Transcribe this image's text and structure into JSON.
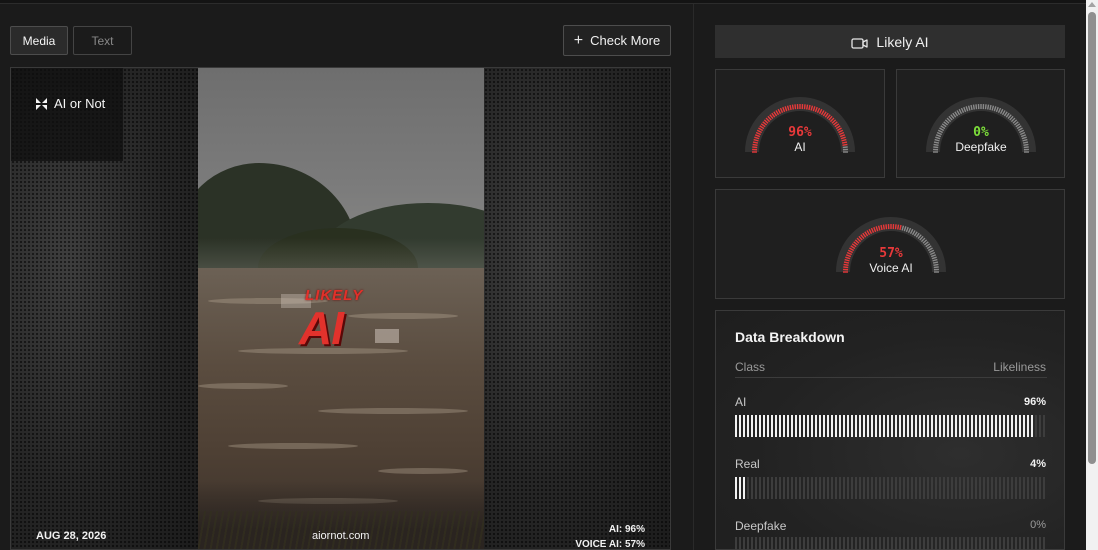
{
  "toolbar": {
    "tab_media": "Media",
    "tab_text": "Text",
    "check_more": "Check More"
  },
  "media": {
    "brand": "AI or Not",
    "stamp_top": "LIKELY",
    "stamp_main": "AI",
    "footer_date": "AUG 28, 2026",
    "footer_site": "aiornot.com",
    "footer_ai": "AI: 96%",
    "footer_voice": "VOICE AI: 57%"
  },
  "verdict": {
    "label": "Likely AI",
    "icon": "video-camera-icon"
  },
  "gauges": [
    {
      "value": "96%",
      "label": "AI",
      "fraction": 0.96,
      "color": "#e8393a"
    },
    {
      "value": "0%",
      "label": "Deepfake",
      "fraction": 0.0,
      "color": "#7dde3a"
    },
    {
      "value": "57%",
      "label": "Voice AI",
      "fraction": 0.57,
      "color": "#e8393a"
    }
  ],
  "breakdown": {
    "title": "Data Breakdown",
    "col_class": "Class",
    "col_likeliness": "Likeliness",
    "rows": [
      {
        "label": "AI",
        "value": "96%",
        "fraction": 0.96
      },
      {
        "label": "Real",
        "value": "4%",
        "fraction": 0.04
      },
      {
        "label": "Deepfake",
        "value": "0%",
        "fraction": 0.0
      }
    ]
  },
  "colors": {
    "danger": "#e8393a",
    "safe": "#7dde3a",
    "background": "#1b1b1b"
  }
}
